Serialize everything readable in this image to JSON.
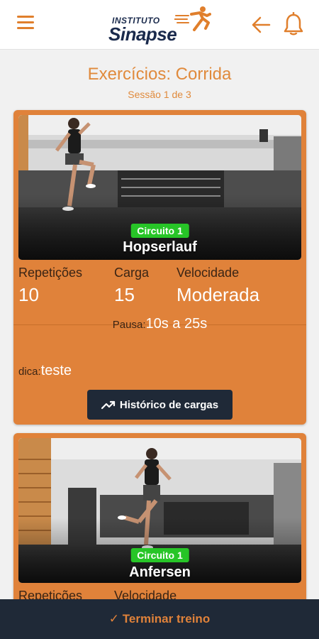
{
  "header": {
    "logo_small": "INSTITUTO",
    "logo_big": "Sinapse",
    "menu_icon": "hamburger-menu-icon",
    "back_icon": "arrow-left-icon",
    "bell_icon": "bell-icon"
  },
  "page": {
    "title": "Exercícios: Corrida",
    "subtitle": "Sessão 1 de 3"
  },
  "exercises": [
    {
      "circuit": "Circuito 1",
      "name": "Hopserlauf",
      "reps_label": "Repetições",
      "reps_value": "10",
      "load_label": "Carga",
      "load_value": "15",
      "speed_label": "Velocidade",
      "speed_value": "Moderada",
      "pause_label": "Pausa:",
      "pause_value": "10s a 25s",
      "tip_label": "dica:",
      "tip_value": "teste",
      "history_button": "Histórico de cargas"
    },
    {
      "circuit": "Circuito 1",
      "name": "Anfersen",
      "reps_label": "Repetições",
      "speed_label": "Velocidade"
    }
  ],
  "footer": {
    "finish_label": "✓ Terminar treino"
  },
  "colors": {
    "accent": "#e0823a",
    "dark": "#1f2937",
    "circuit_green": "#27c527",
    "brand_navy": "#1a2a4c"
  }
}
